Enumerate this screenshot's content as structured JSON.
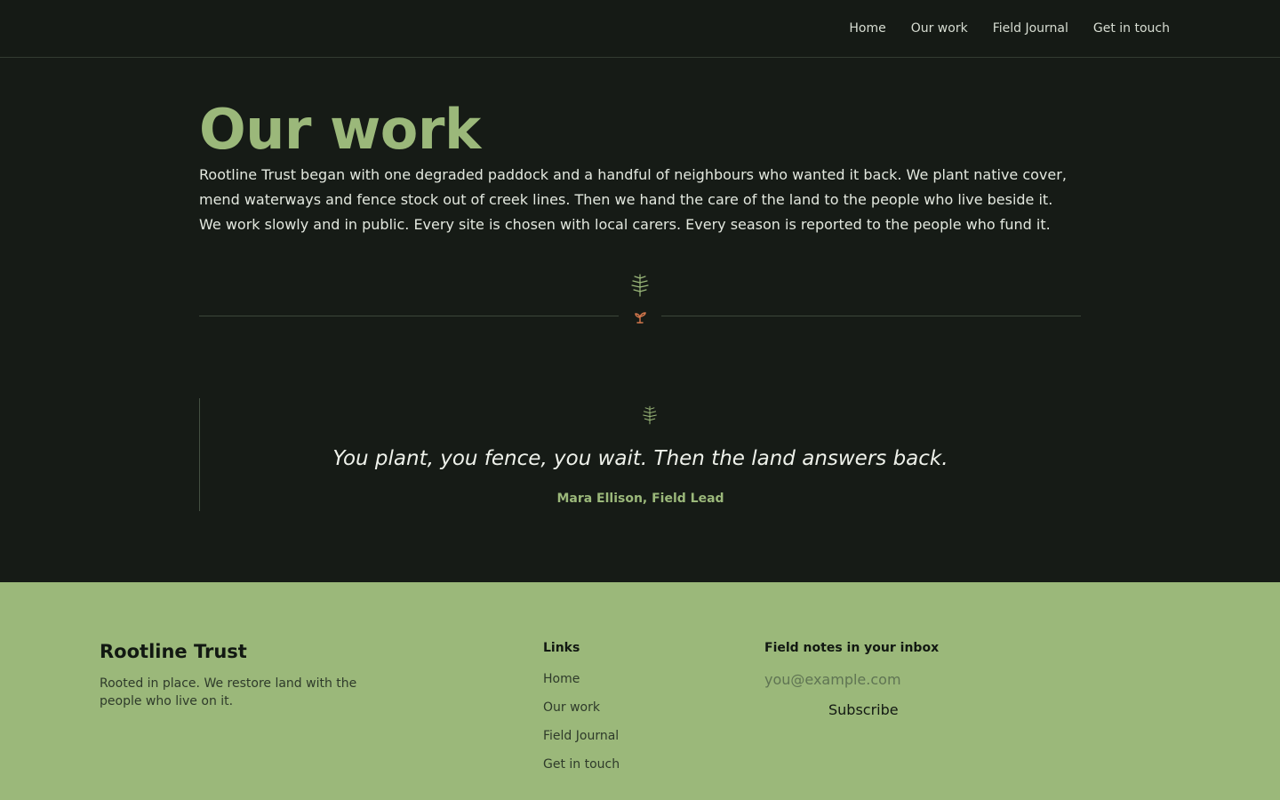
{
  "nav": {
    "items": [
      {
        "label": "Home"
      },
      {
        "label": "Our work"
      },
      {
        "label": "Field Journal"
      },
      {
        "label": "Get in touch"
      }
    ]
  },
  "main": {
    "title": "Our work",
    "intro_p1": "Rootline Trust began with one degraded paddock and a handful of neighbours who wanted it back. We plant native cover, mend waterways and fence stock out of creek lines. Then we hand the care of the land to the people who live beside it.",
    "intro_p2": "We work slowly and in public. Every site is chosen with local carers. Every season is reported to the people who fund it."
  },
  "quote": {
    "text": "You plant, you fence, you wait. Then the land answers back.",
    "author": "Mara Ellison, Field Lead"
  },
  "footer": {
    "brand": "Rootline Trust",
    "tagline": "Rooted in place. We restore land with the people who live on it.",
    "links_heading": "Links",
    "links": [
      {
        "label": "Home"
      },
      {
        "label": "Our work"
      },
      {
        "label": "Field Journal"
      },
      {
        "label": "Get in touch"
      }
    ],
    "newsletter_heading": "Field notes in your inbox",
    "email_placeholder": "you@example.com",
    "subscribe_label": "Subscribe"
  },
  "colors": {
    "background": "#161b16",
    "accent": "#9bb87a",
    "sprout": "#d4774c"
  },
  "icons": [
    "fern-icon",
    "sprout-icon"
  ]
}
